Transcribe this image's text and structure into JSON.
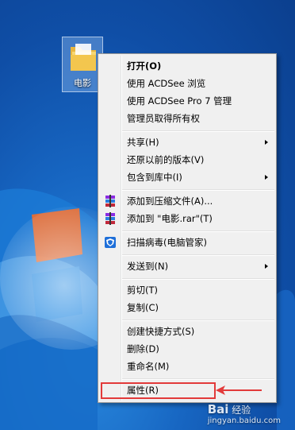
{
  "desktop": {
    "folder_label": "电影"
  },
  "context_menu": {
    "items": [
      {
        "label": "打开(O)"
      },
      {
        "label": "使用 ACDSee 浏览"
      },
      {
        "label": "使用 ACDSee Pro 7 管理"
      },
      {
        "label": "管理员取得所有权"
      },
      {
        "label": "共享(H)"
      },
      {
        "label": "还原以前的版本(V)"
      },
      {
        "label": "包含到库中(I)"
      },
      {
        "label": "添加到压缩文件(A)..."
      },
      {
        "label": "添加到 \"电影.rar\"(T)"
      },
      {
        "label": "扫描病毒(电脑管家)"
      },
      {
        "label": "发送到(N)"
      },
      {
        "label": "剪切(T)"
      },
      {
        "label": "复制(C)"
      },
      {
        "label": "创建快捷方式(S)"
      },
      {
        "label": "删除(D)"
      },
      {
        "label": "重命名(M)"
      },
      {
        "label": "属性(R)"
      }
    ]
  },
  "watermark": {
    "logo_text": "Bai",
    "brand": "经验",
    "url": "jingyan.baidu.com"
  },
  "colors": {
    "highlight": "#e23a3a",
    "menu_bg": "#f0f0f0"
  }
}
